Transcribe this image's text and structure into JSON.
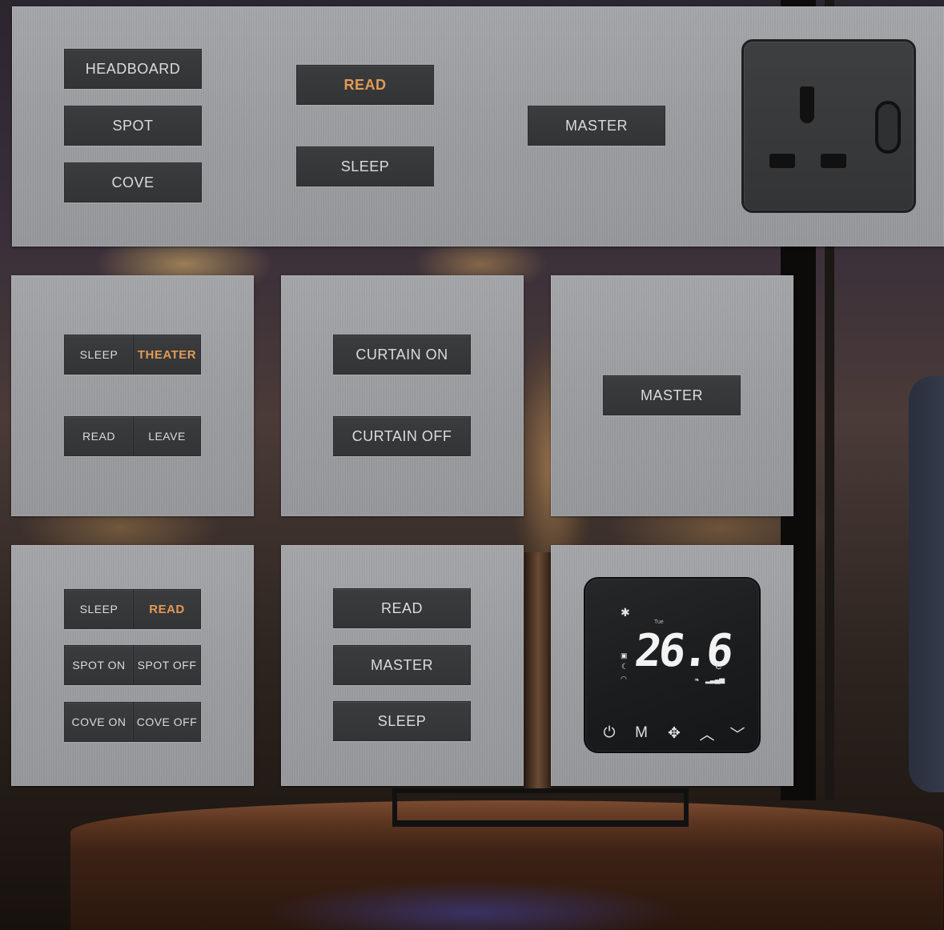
{
  "panel_top": {
    "headboard_label": "HEADBOARD",
    "spot_label": "SPOT",
    "cove_label": "COVE",
    "read_label": "READ",
    "sleep_label": "SLEEP",
    "master_label": "MASTER"
  },
  "panel_scene_a": {
    "sleep_label": "SLEEP",
    "theater_label": "THEATER",
    "read_label": "READ",
    "leave_label": "LEAVE"
  },
  "panel_curtain": {
    "curtain_on_label": "CURTAIN ON",
    "curtain_off_label": "CURTAIN OFF"
  },
  "panel_master": {
    "master_label": "MASTER"
  },
  "panel_scene_b": {
    "sleep_label": "SLEEP",
    "read_label": "READ",
    "spot_on_label": "SPOT ON",
    "spot_off_label": "SPOT OFF",
    "cove_on_label": "COVE ON",
    "cove_off_label": "COVE OFF"
  },
  "panel_modes": {
    "read_label": "READ",
    "master_label": "MASTER",
    "sleep_label": "SLEEP"
  },
  "thermostat": {
    "day": "Tue",
    "temperature": "26.6",
    "unit": "°C",
    "mode_label": "M"
  },
  "colors": {
    "plate": "#9c9d a0",
    "button": "#353638",
    "button_text": "#dcdcdc",
    "highlight_text": "#e29a58"
  }
}
